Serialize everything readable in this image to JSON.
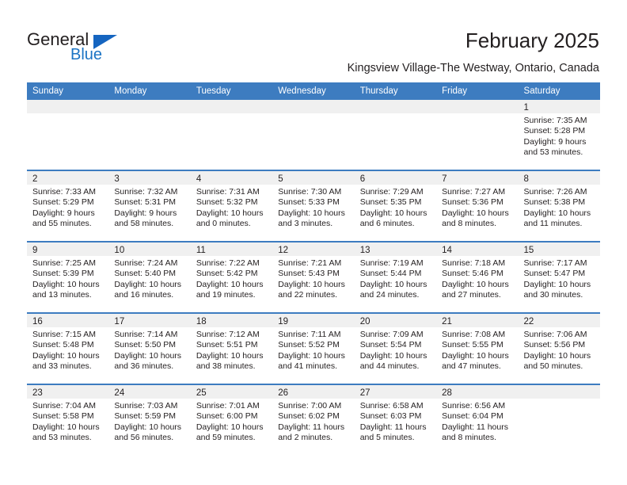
{
  "brand": {
    "name_part1": "General",
    "name_part2": "Blue",
    "triangle_icon": "triangle-icon",
    "color_primary": "#1565c0",
    "color_text": "#231f20"
  },
  "header": {
    "title": "February 2025",
    "subtitle": "Kingsview Village-The Westway, Ontario, Canada"
  },
  "calendar": {
    "header_bg": "#3d7cc0",
    "header_text_color": "#ffffff",
    "row_band_bg": "#f0f0f0",
    "weekdays": [
      "Sunday",
      "Monday",
      "Tuesday",
      "Wednesday",
      "Thursday",
      "Friday",
      "Saturday"
    ],
    "weeks": [
      [
        {
          "day": "",
          "sunrise": "",
          "sunset": "",
          "daylight_line1": "",
          "daylight_line2": "",
          "empty": true
        },
        {
          "day": "",
          "sunrise": "",
          "sunset": "",
          "daylight_line1": "",
          "daylight_line2": "",
          "empty": true
        },
        {
          "day": "",
          "sunrise": "",
          "sunset": "",
          "daylight_line1": "",
          "daylight_line2": "",
          "empty": true
        },
        {
          "day": "",
          "sunrise": "",
          "sunset": "",
          "daylight_line1": "",
          "daylight_line2": "",
          "empty": true
        },
        {
          "day": "",
          "sunrise": "",
          "sunset": "",
          "daylight_line1": "",
          "daylight_line2": "",
          "empty": true
        },
        {
          "day": "",
          "sunrise": "",
          "sunset": "",
          "daylight_line1": "",
          "daylight_line2": "",
          "empty": true
        },
        {
          "day": "1",
          "sunrise": "Sunrise: 7:35 AM",
          "sunset": "Sunset: 5:28 PM",
          "daylight_line1": "Daylight: 9 hours",
          "daylight_line2": "and 53 minutes.",
          "empty": false
        }
      ],
      [
        {
          "day": "2",
          "sunrise": "Sunrise: 7:33 AM",
          "sunset": "Sunset: 5:29 PM",
          "daylight_line1": "Daylight: 9 hours",
          "daylight_line2": "and 55 minutes.",
          "empty": false
        },
        {
          "day": "3",
          "sunrise": "Sunrise: 7:32 AM",
          "sunset": "Sunset: 5:31 PM",
          "daylight_line1": "Daylight: 9 hours",
          "daylight_line2": "and 58 minutes.",
          "empty": false
        },
        {
          "day": "4",
          "sunrise": "Sunrise: 7:31 AM",
          "sunset": "Sunset: 5:32 PM",
          "daylight_line1": "Daylight: 10 hours",
          "daylight_line2": "and 0 minutes.",
          "empty": false
        },
        {
          "day": "5",
          "sunrise": "Sunrise: 7:30 AM",
          "sunset": "Sunset: 5:33 PM",
          "daylight_line1": "Daylight: 10 hours",
          "daylight_line2": "and 3 minutes.",
          "empty": false
        },
        {
          "day": "6",
          "sunrise": "Sunrise: 7:29 AM",
          "sunset": "Sunset: 5:35 PM",
          "daylight_line1": "Daylight: 10 hours",
          "daylight_line2": "and 6 minutes.",
          "empty": false
        },
        {
          "day": "7",
          "sunrise": "Sunrise: 7:27 AM",
          "sunset": "Sunset: 5:36 PM",
          "daylight_line1": "Daylight: 10 hours",
          "daylight_line2": "and 8 minutes.",
          "empty": false
        },
        {
          "day": "8",
          "sunrise": "Sunrise: 7:26 AM",
          "sunset": "Sunset: 5:38 PM",
          "daylight_line1": "Daylight: 10 hours",
          "daylight_line2": "and 11 minutes.",
          "empty": false
        }
      ],
      [
        {
          "day": "9",
          "sunrise": "Sunrise: 7:25 AM",
          "sunset": "Sunset: 5:39 PM",
          "daylight_line1": "Daylight: 10 hours",
          "daylight_line2": "and 13 minutes.",
          "empty": false
        },
        {
          "day": "10",
          "sunrise": "Sunrise: 7:24 AM",
          "sunset": "Sunset: 5:40 PM",
          "daylight_line1": "Daylight: 10 hours",
          "daylight_line2": "and 16 minutes.",
          "empty": false
        },
        {
          "day": "11",
          "sunrise": "Sunrise: 7:22 AM",
          "sunset": "Sunset: 5:42 PM",
          "daylight_line1": "Daylight: 10 hours",
          "daylight_line2": "and 19 minutes.",
          "empty": false
        },
        {
          "day": "12",
          "sunrise": "Sunrise: 7:21 AM",
          "sunset": "Sunset: 5:43 PM",
          "daylight_line1": "Daylight: 10 hours",
          "daylight_line2": "and 22 minutes.",
          "empty": false
        },
        {
          "day": "13",
          "sunrise": "Sunrise: 7:19 AM",
          "sunset": "Sunset: 5:44 PM",
          "daylight_line1": "Daylight: 10 hours",
          "daylight_line2": "and 24 minutes.",
          "empty": false
        },
        {
          "day": "14",
          "sunrise": "Sunrise: 7:18 AM",
          "sunset": "Sunset: 5:46 PM",
          "daylight_line1": "Daylight: 10 hours",
          "daylight_line2": "and 27 minutes.",
          "empty": false
        },
        {
          "day": "15",
          "sunrise": "Sunrise: 7:17 AM",
          "sunset": "Sunset: 5:47 PM",
          "daylight_line1": "Daylight: 10 hours",
          "daylight_line2": "and 30 minutes.",
          "empty": false
        }
      ],
      [
        {
          "day": "16",
          "sunrise": "Sunrise: 7:15 AM",
          "sunset": "Sunset: 5:48 PM",
          "daylight_line1": "Daylight: 10 hours",
          "daylight_line2": "and 33 minutes.",
          "empty": false
        },
        {
          "day": "17",
          "sunrise": "Sunrise: 7:14 AM",
          "sunset": "Sunset: 5:50 PM",
          "daylight_line1": "Daylight: 10 hours",
          "daylight_line2": "and 36 minutes.",
          "empty": false
        },
        {
          "day": "18",
          "sunrise": "Sunrise: 7:12 AM",
          "sunset": "Sunset: 5:51 PM",
          "daylight_line1": "Daylight: 10 hours",
          "daylight_line2": "and 38 minutes.",
          "empty": false
        },
        {
          "day": "19",
          "sunrise": "Sunrise: 7:11 AM",
          "sunset": "Sunset: 5:52 PM",
          "daylight_line1": "Daylight: 10 hours",
          "daylight_line2": "and 41 minutes.",
          "empty": false
        },
        {
          "day": "20",
          "sunrise": "Sunrise: 7:09 AM",
          "sunset": "Sunset: 5:54 PM",
          "daylight_line1": "Daylight: 10 hours",
          "daylight_line2": "and 44 minutes.",
          "empty": false
        },
        {
          "day": "21",
          "sunrise": "Sunrise: 7:08 AM",
          "sunset": "Sunset: 5:55 PM",
          "daylight_line1": "Daylight: 10 hours",
          "daylight_line2": "and 47 minutes.",
          "empty": false
        },
        {
          "day": "22",
          "sunrise": "Sunrise: 7:06 AM",
          "sunset": "Sunset: 5:56 PM",
          "daylight_line1": "Daylight: 10 hours",
          "daylight_line2": "and 50 minutes.",
          "empty": false
        }
      ],
      [
        {
          "day": "23",
          "sunrise": "Sunrise: 7:04 AM",
          "sunset": "Sunset: 5:58 PM",
          "daylight_line1": "Daylight: 10 hours",
          "daylight_line2": "and 53 minutes.",
          "empty": false
        },
        {
          "day": "24",
          "sunrise": "Sunrise: 7:03 AM",
          "sunset": "Sunset: 5:59 PM",
          "daylight_line1": "Daylight: 10 hours",
          "daylight_line2": "and 56 minutes.",
          "empty": false
        },
        {
          "day": "25",
          "sunrise": "Sunrise: 7:01 AM",
          "sunset": "Sunset: 6:00 PM",
          "daylight_line1": "Daylight: 10 hours",
          "daylight_line2": "and 59 minutes.",
          "empty": false
        },
        {
          "day": "26",
          "sunrise": "Sunrise: 7:00 AM",
          "sunset": "Sunset: 6:02 PM",
          "daylight_line1": "Daylight: 11 hours",
          "daylight_line2": "and 2 minutes.",
          "empty": false
        },
        {
          "day": "27",
          "sunrise": "Sunrise: 6:58 AM",
          "sunset": "Sunset: 6:03 PM",
          "daylight_line1": "Daylight: 11 hours",
          "daylight_line2": "and 5 minutes.",
          "empty": false
        },
        {
          "day": "28",
          "sunrise": "Sunrise: 6:56 AM",
          "sunset": "Sunset: 6:04 PM",
          "daylight_line1": "Daylight: 11 hours",
          "daylight_line2": "and 8 minutes.",
          "empty": false
        },
        {
          "day": "",
          "sunrise": "",
          "sunset": "",
          "daylight_line1": "",
          "daylight_line2": "",
          "empty": true
        }
      ]
    ]
  }
}
